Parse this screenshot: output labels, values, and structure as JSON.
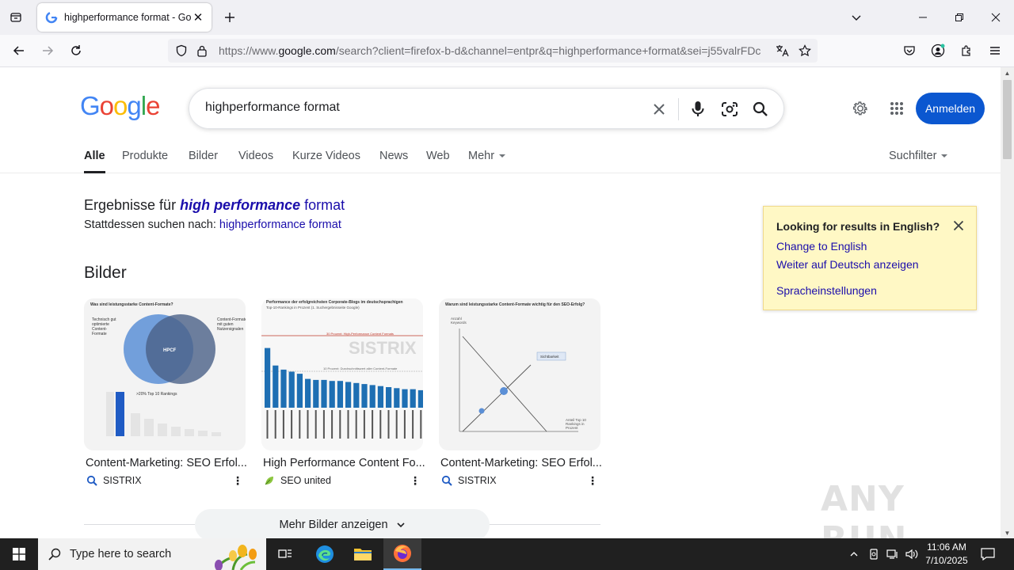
{
  "browser": {
    "tab_title": "highperformance format - Goog",
    "url_prefix": "https://www.",
    "url_host": "google.com",
    "url_rest": "/search?client=firefox-b-d&channel=entpr&q=highperformance+format&sei=j55valrFDc"
  },
  "google": {
    "logo_letters": [
      "G",
      "o",
      "o",
      "g",
      "l",
      "e"
    ],
    "logo_colors": [
      "#4285f4",
      "#ea4335",
      "#fbbc05",
      "#4285f4",
      "#34a853",
      "#ea4335"
    ],
    "query": "highperformance format",
    "signin_label": "Anmelden",
    "tabs": [
      "Alle",
      "Produkte",
      "Bilder",
      "Videos",
      "Kurze Videos",
      "News",
      "Web",
      "Mehr"
    ],
    "search_filter_label": "Suchfilter"
  },
  "spelling": {
    "prefix": "Ergebnisse für",
    "corrected_emph": "high performance",
    "corrected_rest": "format",
    "instead_prefix": "Stattdessen suchen nach:",
    "instead_link": "highperformance format"
  },
  "language_box": {
    "title": "Looking for results in English?",
    "link_english": "Change to English",
    "link_german": "Weiter auf Deutsch anzeigen",
    "link_settings": "Spracheinstellungen"
  },
  "images_section": {
    "title": "Bilder",
    "cards": [
      {
        "caption": "Content-Marketing: SEO Erfol...",
        "source": "SISTRIX"
      },
      {
        "caption": "High Performance Content Fo...",
        "source": "SEO united"
      },
      {
        "caption": "Content-Marketing: SEO Erfol...",
        "source": "SISTRIX"
      }
    ],
    "card1": {
      "header": "Was sind leistungsstarke Content-Formate?",
      "left_label": "Technisch gut optimierte Content-Formate",
      "right_label": "Content-Formate mit guten Nutzersignalen",
      "center_label": "HPCF",
      "bar_label": ">20% Top 10 Rankings"
    },
    "card2": {
      "header": "Performance der erfolgreichsten Corporate-Blogs im deutschsprachigen",
      "subheader": "Top-10-Rankings in Prozent (1. Suchergebnisseite Google)",
      "line1": "30 Prozent: High-Performance Content Formats",
      "line2": "10 Prozent: Durchschnittswert aller Content-Formate",
      "watermark": "SISTRIX",
      "bar_values": [
        58,
        41,
        37,
        35,
        33,
        28,
        27,
        27,
        26,
        26,
        25,
        24,
        23,
        22,
        21,
        20,
        19,
        18,
        18,
        17
      ]
    },
    "card3": {
      "header": "Warum sind leistungsstarke Content-Formate wichtig für den SEO-Erfolg?",
      "y_label": "Anzahl Keywords",
      "x_label": "Anteil Top 10 Rankings in Prozent",
      "tag": "Sichtbarkeit"
    },
    "more_label": "Mehr Bilder anzeigen"
  },
  "watermark_text": "ANY RUN",
  "taskbar": {
    "search_placeholder": "Type here to search",
    "time": "11:06 AM",
    "date": "7/10/2025"
  }
}
